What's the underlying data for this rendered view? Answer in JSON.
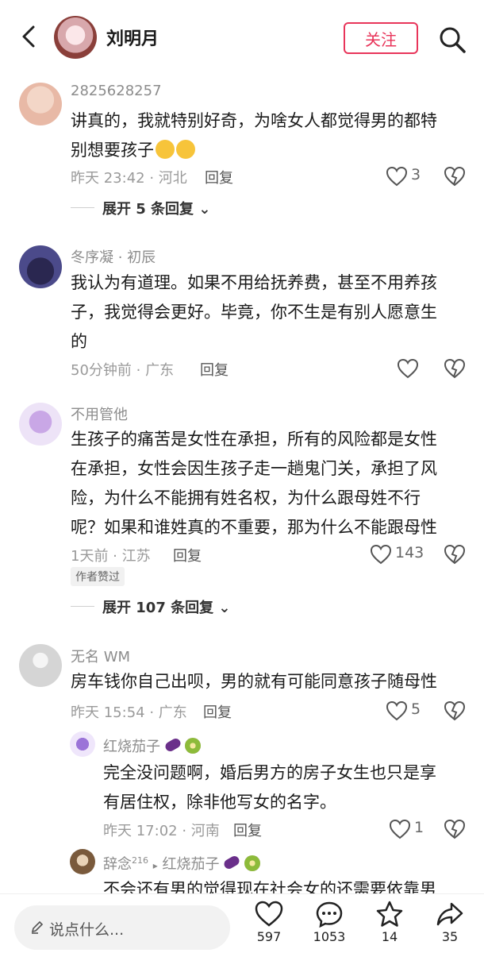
{
  "header": {
    "author_name": "刘明月",
    "follow_label": "关注"
  },
  "comments": [
    {
      "username": "2825628257",
      "text_lines": [
        "讲真的，我就特别好奇，为啥女人都觉得男的都特",
        "别想要孩子"
      ],
      "meta": "昨天 23:42 · 河北",
      "reply_label": "回复",
      "likes": "3",
      "expand_label": "展开 5 条回复"
    },
    {
      "username": "冬序凝 · 初辰",
      "text_lines": [
        "我认为有道理。如果不用给抚养费，甚至不用养孩",
        "子，我觉得会更好。毕竟，你不生是有别人愿意生",
        "的"
      ],
      "meta": "50分钟前 · 广东",
      "reply_label": "回复"
    },
    {
      "username": "不用管他",
      "text_lines": [
        "生孩子的痛苦是女性在承担，所有的风险都是女性",
        "在承担，女性会因生孩子走一趟鬼门关，承担了风",
        "险，为什么不能拥有姓名权，为什么跟母姓不行",
        "呢？如果和谁姓真的不重要，那为什么不能跟母性"
      ],
      "meta": "1天前 · 江苏",
      "reply_label": "回复",
      "likes": "143",
      "badge": "作者赞过",
      "expand_label": "展开 107 条回复"
    },
    {
      "username": "无名 WM",
      "text_lines": [
        "房车钱你自己出呗，男的就有可能同意孩子随母性"
      ],
      "meta": "昨天 15:54 · 广东",
      "reply_label": "回复",
      "likes": "5"
    }
  ],
  "replies": [
    {
      "username": "红烧茄子",
      "text_lines": [
        "完全没问题啊，婚后男方的房子女生也只是享",
        "有居住权，除非他写女的名字。"
      ],
      "meta": "昨天 17:02 · 河南",
      "reply_label": "回复",
      "likes": "1"
    },
    {
      "username": "辞念",
      "level": "216",
      "target": "红烧茄子",
      "text_lines": [
        "不会还有男的觉得现在社会女的还需要依靠男"
      ]
    }
  ],
  "bottom_bar": {
    "input_placeholder": "说点什么...",
    "likes": "597",
    "comments": "1053",
    "favorites": "14",
    "shares": "35"
  },
  "colors": {
    "accent": "#e8355a"
  }
}
